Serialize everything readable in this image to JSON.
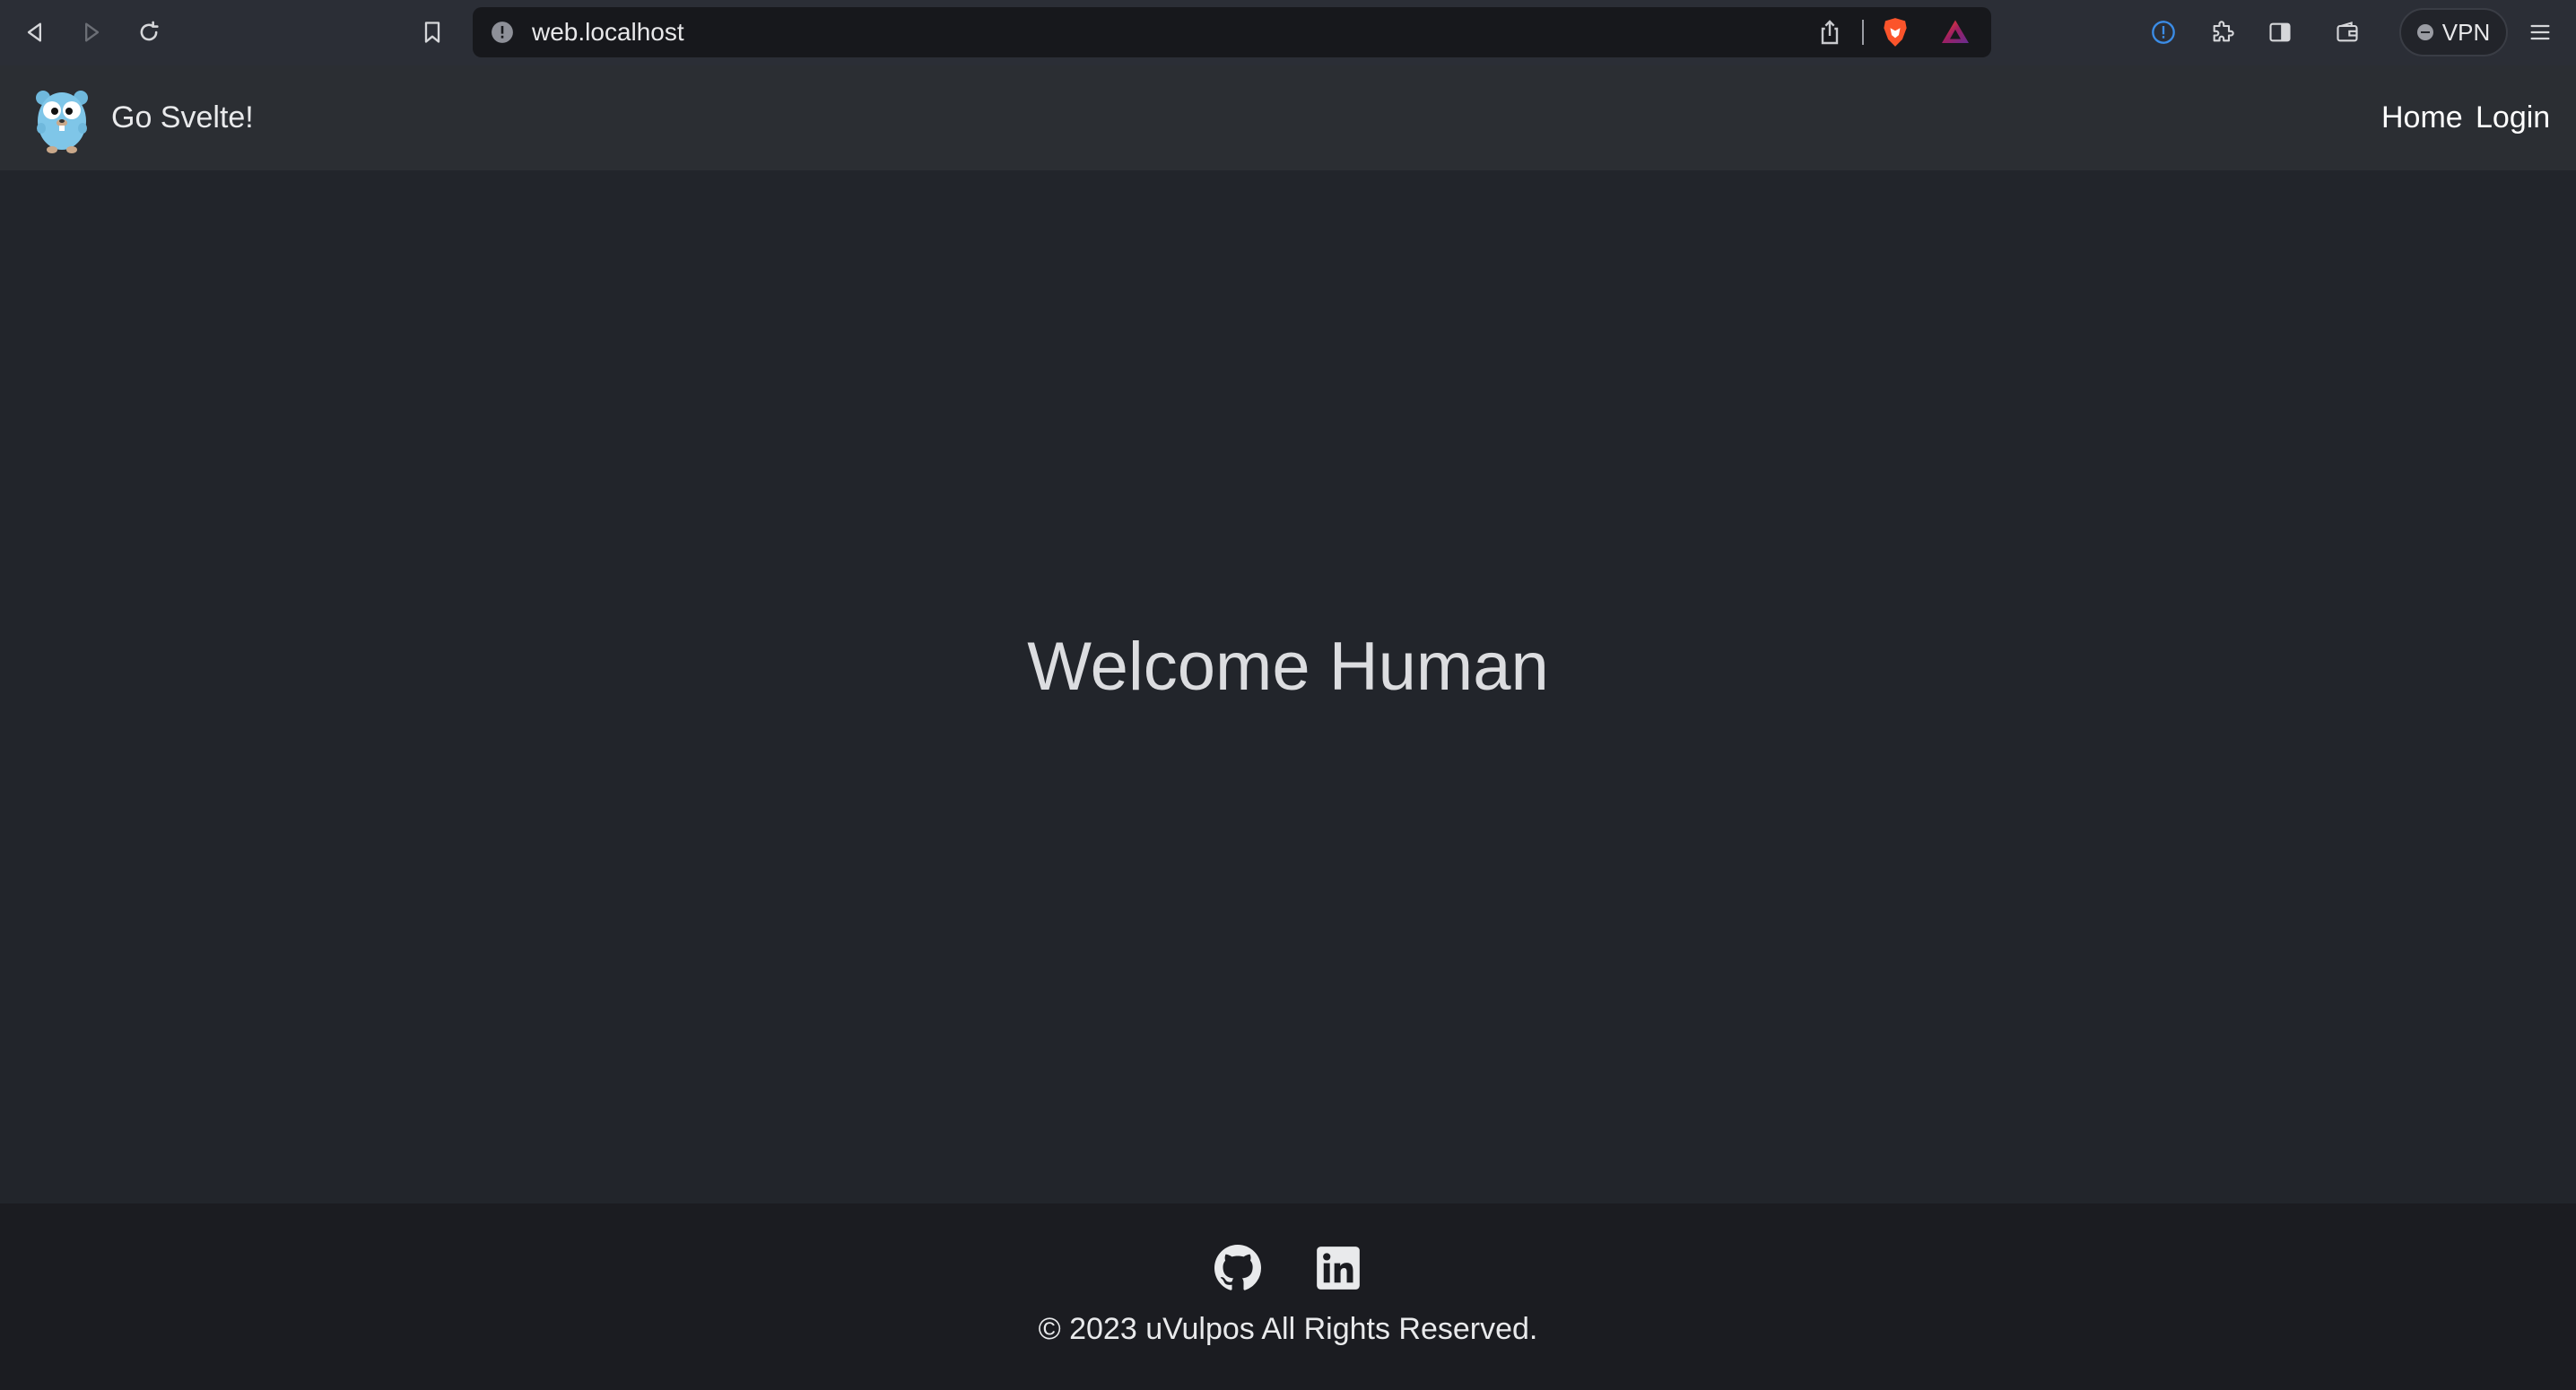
{
  "browser": {
    "url": "web.localhost",
    "vpn_label": "VPN",
    "icons": [
      "back-icon",
      "forward-icon",
      "reload-icon",
      "bookmark-icon",
      "site-info-icon",
      "share-icon",
      "brave-shields-icon",
      "brave-rewards-icon",
      "password-manager-icon",
      "extensions-icon",
      "sidebar-icon",
      "wallet-icon",
      "menu-icon"
    ]
  },
  "navbar": {
    "brand": "Go Svelte!",
    "links": [
      {
        "label": "Home"
      },
      {
        "label": "Login"
      }
    ]
  },
  "main": {
    "heading": "Welcome Human"
  },
  "footer": {
    "social_icons": [
      "github-icon",
      "linkedin-icon"
    ],
    "copyright": "© 2023 uVulpos All Rights Reserved."
  },
  "colors": {
    "page_background": "#22252b",
    "navbar_background": "#2b2e33",
    "footer_background": "#1b1c21",
    "text": "#e9eaec",
    "brand_mascot": "#7fc6e8"
  }
}
